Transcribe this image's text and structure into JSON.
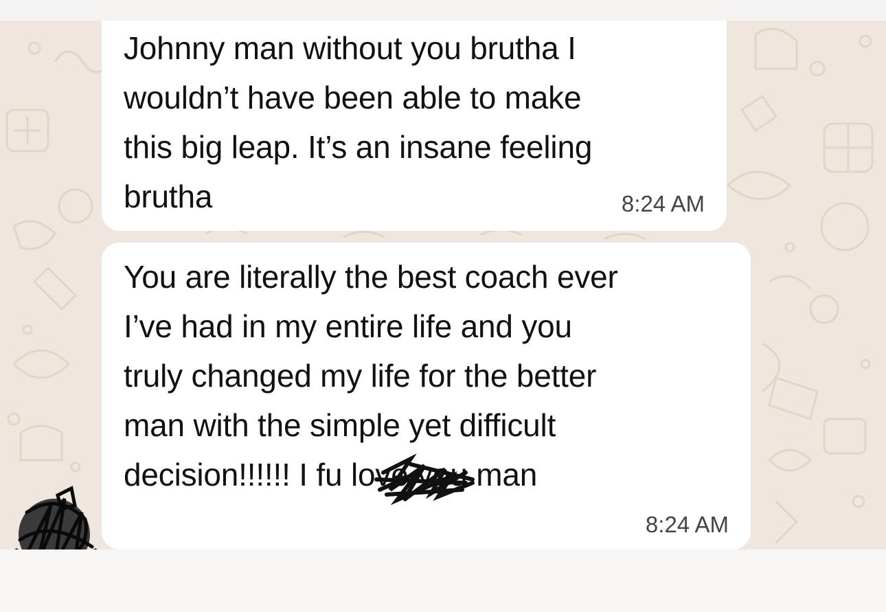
{
  "messages": [
    {
      "text": "Johnny man without you brutha  I\nwouldn’t have been able to make\nthis big leap. It’s an insane feeling\nbrutha",
      "time": "8:24 AM"
    },
    {
      "text": "You are literally the best coach ever\nI’ve had in my entire life and you\ntruly changed my life for the better\nman with the simple yet difficult\ndecision!!!!!! I fu         love you man",
      "time": "8:24 AM"
    }
  ],
  "colors": {
    "wallpaper": "#efe7de",
    "bubble": "#ffffff",
    "redaction": "#111111"
  },
  "icons": [
    "avatar-scribbled",
    "redaction-scribble"
  ]
}
